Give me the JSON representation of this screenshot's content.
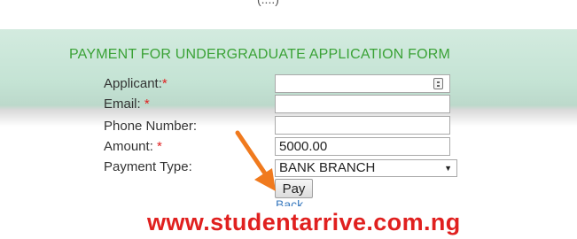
{
  "top_fragment": "(....)",
  "form": {
    "title": "PAYMENT FOR UNDERGRADUATE APPLICATION FORM",
    "required_marker": "*",
    "fields": {
      "applicant": {
        "label": "Applicant:",
        "value": ""
      },
      "email": {
        "label": "Email: ",
        "value": ""
      },
      "phone": {
        "label": "Phone Number:",
        "value": ""
      },
      "amount": {
        "label": "Amount: ",
        "value": "5000.00"
      },
      "payment_type": {
        "label": "Payment Type:",
        "selected": "BANK BRANCH"
      }
    },
    "pay_label": "Pay",
    "back_label": "Back"
  },
  "watermark": "www.studentarrive.com.ng",
  "colors": {
    "title_green": "#3aa236",
    "required_red": "#e02020",
    "arrow_orange": "#f07a1e",
    "watermark_red": "#e0201f",
    "link_blue": "#3b7bbf"
  },
  "icons": {
    "applicant_field_icon": "contact-card-icon",
    "select_arrow": "dropdown-arrow-icon",
    "annotation": "orange-arrow-icon"
  }
}
